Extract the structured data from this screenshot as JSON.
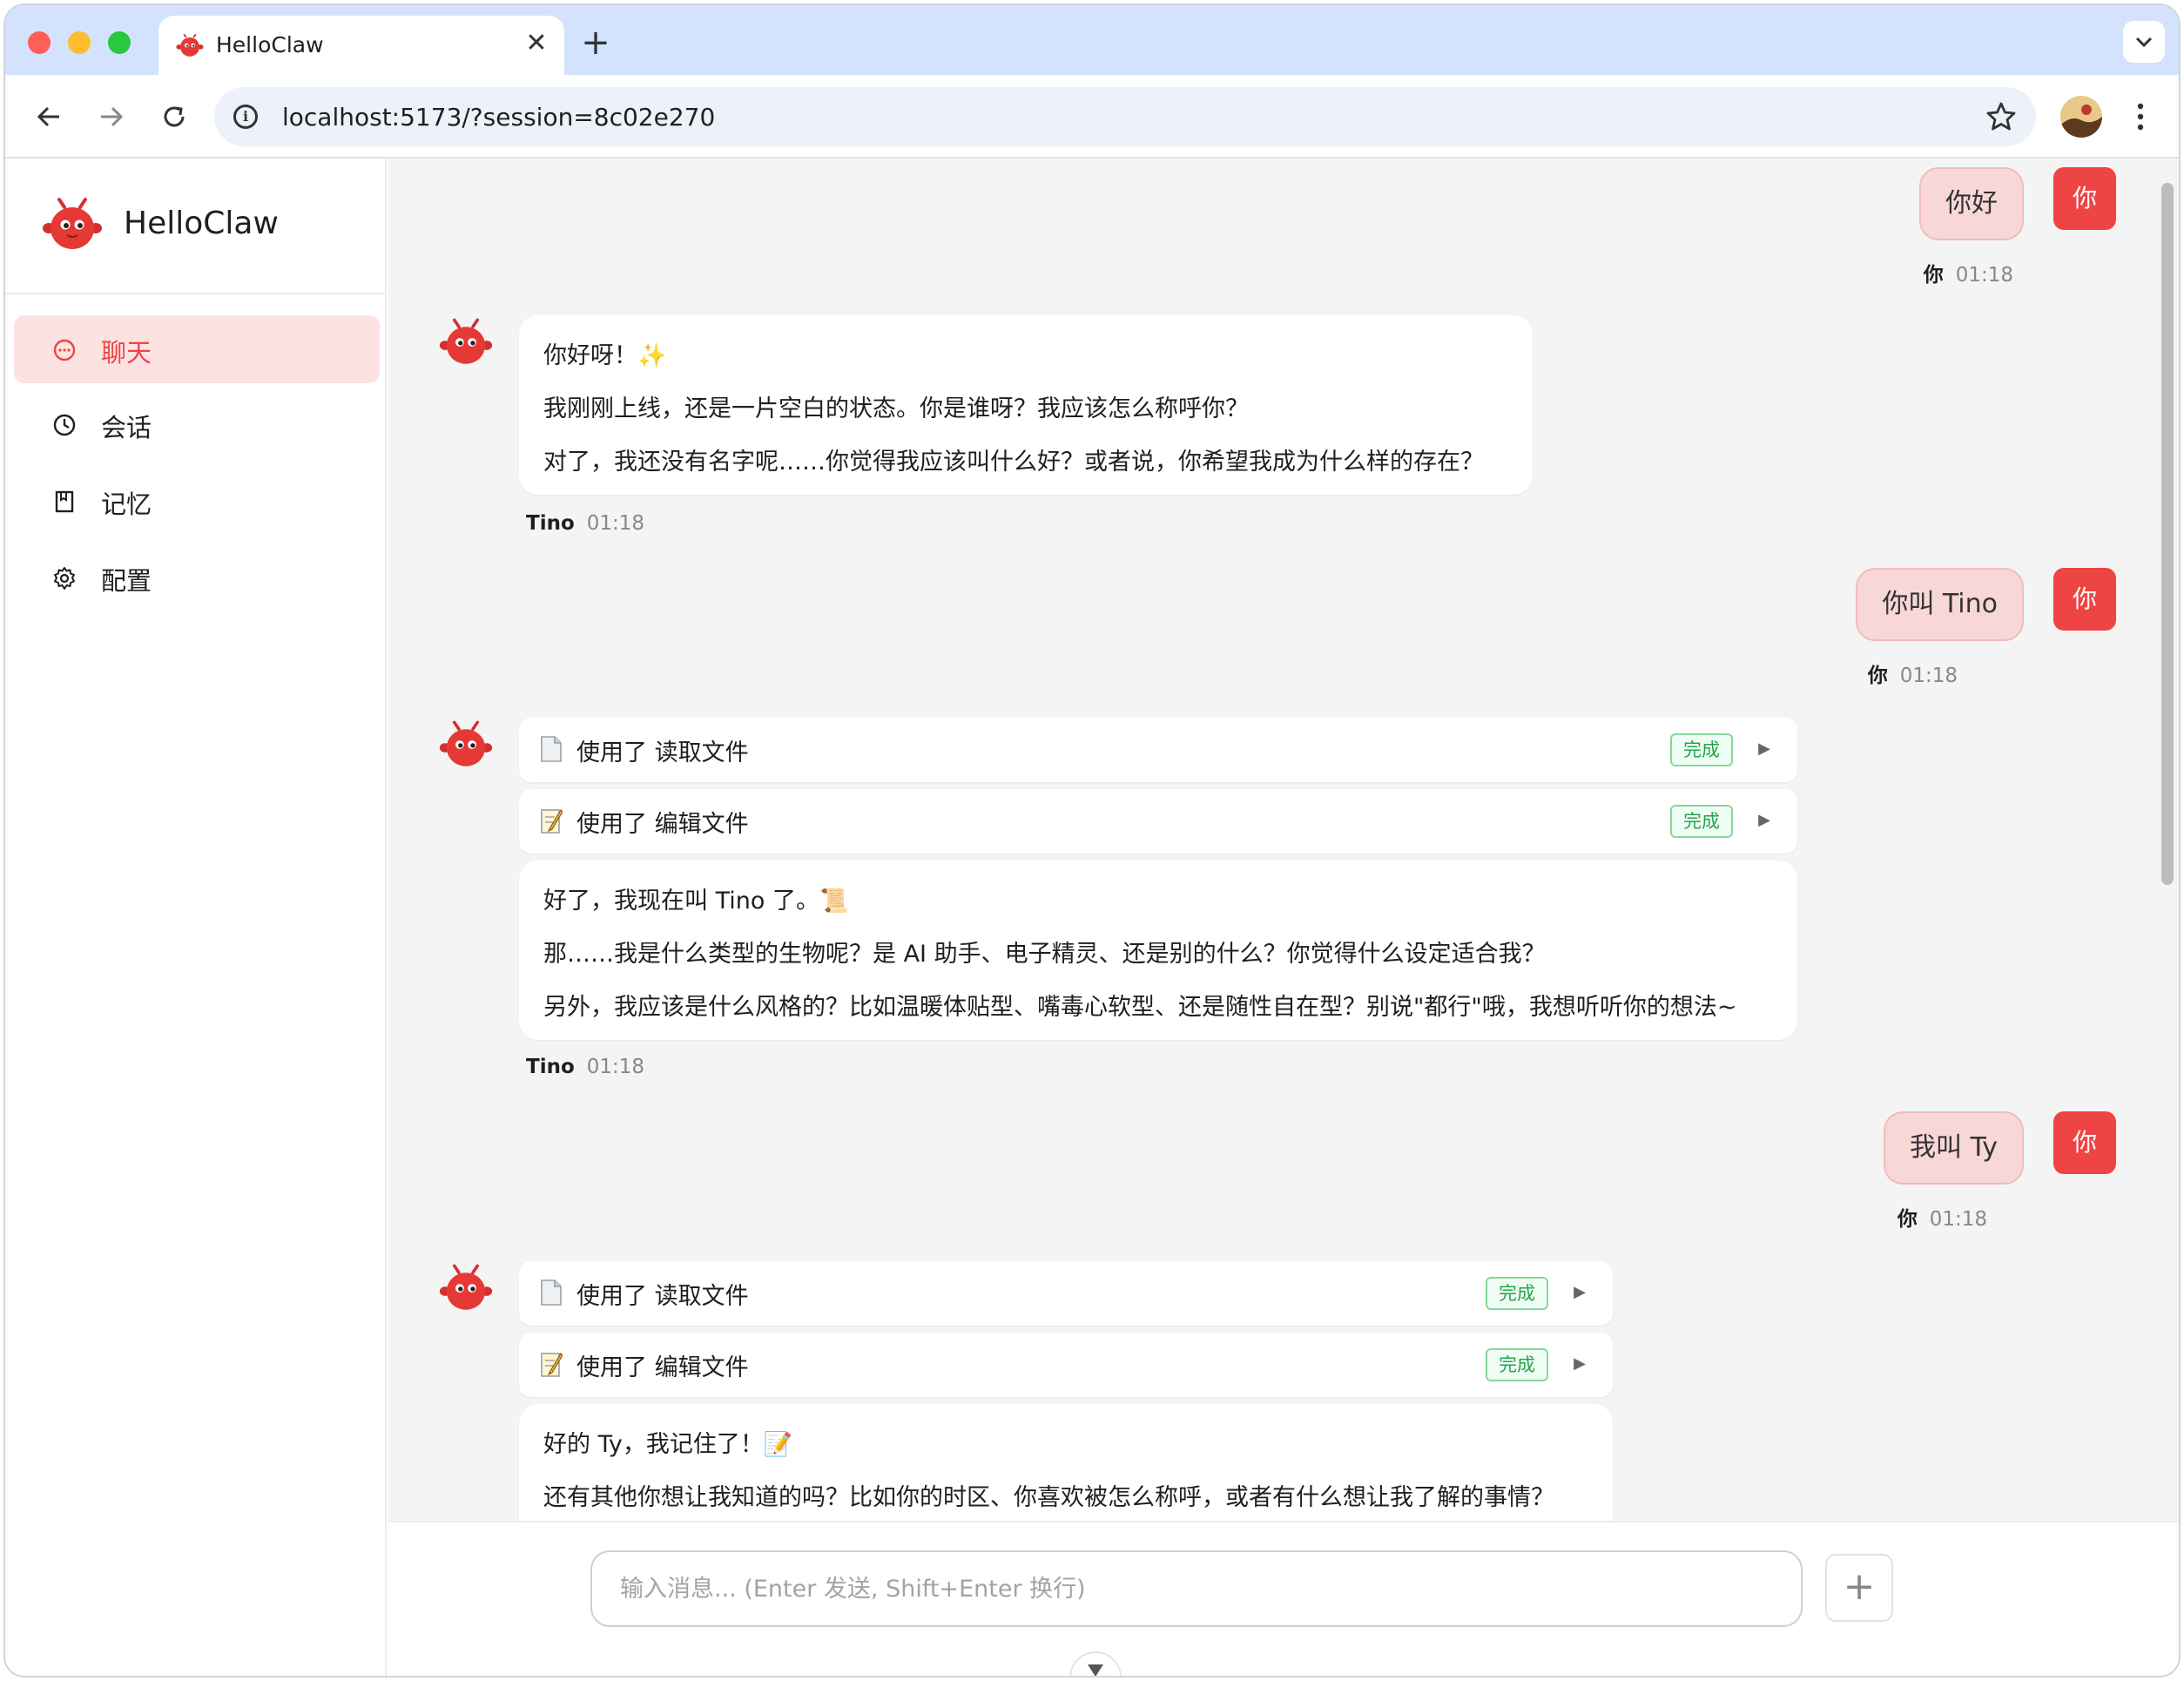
{
  "browser": {
    "tab_title": "HelloClaw",
    "tab_close": "✕",
    "new_tab": "+",
    "url": "localhost:5173/?session=8c02e270"
  },
  "sidebar": {
    "brand": "HelloClaw",
    "items": [
      {
        "label": "聊天",
        "icon": "chat-bubble-icon",
        "active": true
      },
      {
        "label": "会话",
        "icon": "clock-icon",
        "active": false
      },
      {
        "label": "记忆",
        "icon": "bookmark-icon",
        "active": false
      },
      {
        "label": "配置",
        "icon": "gear-icon",
        "active": false
      }
    ]
  },
  "chat": {
    "user_avatar_label": "你",
    "messages": [
      {
        "role": "user",
        "text": "你好",
        "sender": "你",
        "time": "01:18"
      },
      {
        "role": "assistant",
        "sender": "Tino",
        "time": "01:18",
        "tools": [],
        "lines": [
          "你好呀！✨",
          "我刚刚上线，还是一片空白的状态。你是谁呀？我应该怎么称呼你？",
          "对了，我还没有名字呢……你觉得我应该叫什么好？或者说，你希望我成为什么样的存在？"
        ]
      },
      {
        "role": "user",
        "text": "你叫 Tino",
        "sender": "你",
        "time": "01:18"
      },
      {
        "role": "assistant",
        "sender": "Tino",
        "time": "01:18",
        "tools": [
          {
            "label": "使用了 读取文件",
            "status": "完成",
            "icon": "document-icon"
          },
          {
            "label": "使用了 编辑文件",
            "status": "完成",
            "icon": "memo-icon"
          }
        ],
        "lines": [
          "好了，我现在叫 Tino 了。📜",
          "那……我是什么类型的生物呢？是 AI 助手、电子精灵、还是别的什么？你觉得什么设定适合我？",
          "另外，我应该是什么风格的？比如温暖体贴型、嘴毒心软型、还是随性自在型？别说\"都行\"哦，我想听听你的想法~"
        ]
      },
      {
        "role": "user",
        "text": "我叫 Ty",
        "sender": "你",
        "time": "01:18"
      },
      {
        "role": "assistant",
        "tools": [
          {
            "label": "使用了 读取文件",
            "status": "完成",
            "icon": "document-icon"
          },
          {
            "label": "使用了 编辑文件",
            "status": "完成",
            "icon": "memo-icon"
          }
        ],
        "lines": [
          "好的 Ty，我记住了！📝",
          "还有其他你想让我知道的吗？比如你的时区、你喜欢被怎么称呼，或者有什么想让我了解的事情？"
        ]
      }
    ]
  },
  "composer": {
    "placeholder": "输入消息... (Enter 发送, Shift+Enter 换行)",
    "attach_label": "+"
  },
  "colors": {
    "accent": "#ef4444",
    "user_bubble": "#f8d7d7",
    "active_nav": "#fde2e2",
    "badge_green": "#22a64a",
    "tab_strip": "#d3e3fd"
  }
}
